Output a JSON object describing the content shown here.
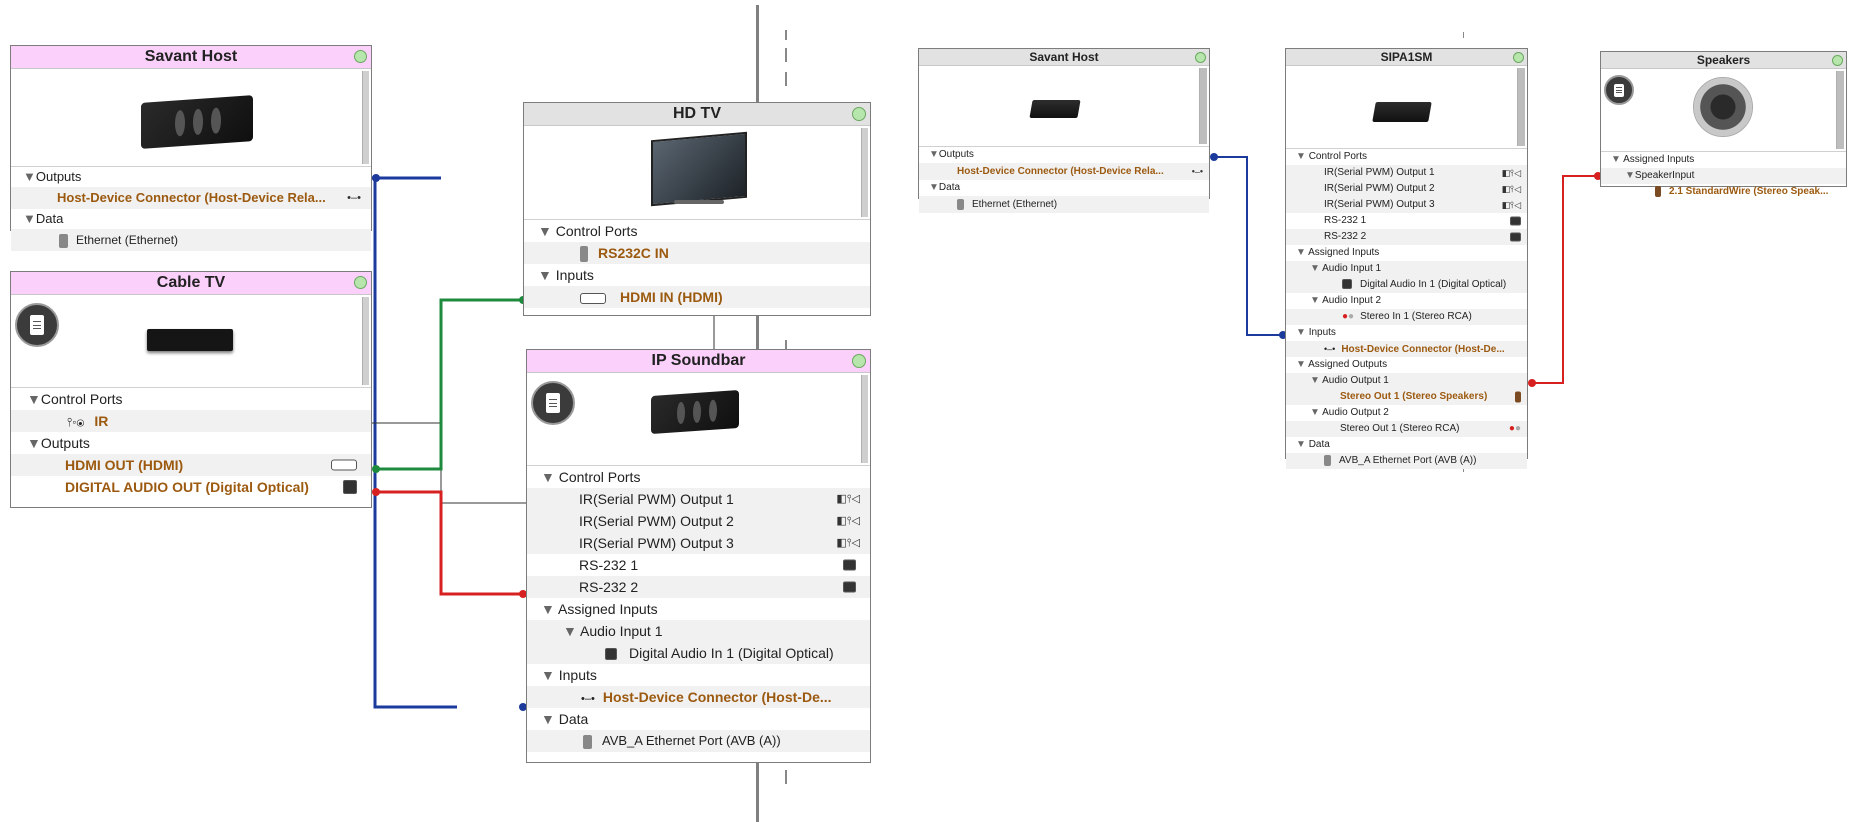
{
  "left": {
    "savant_host": {
      "title": "Savant Host",
      "outputs": "Outputs",
      "connector": "Host-Device Connector (Host-Device Rela...",
      "data": "Data",
      "ethernet": "Ethernet (Ethernet)"
    },
    "cable_tv": {
      "title": "Cable TV",
      "control_ports": "Control Ports",
      "ir": "IR",
      "outputs": "Outputs",
      "hdmi_out": "HDMI OUT (HDMI)",
      "digital_out": "DIGITAL AUDIO OUT (Digital Optical)"
    },
    "hd_tv": {
      "title": "HD TV",
      "control_ports": "Control Ports",
      "rs232": "RS232C IN",
      "inputs": "Inputs",
      "hdmi_in": "HDMI IN (HDMI)"
    },
    "ip_soundbar": {
      "title": "IP Soundbar",
      "control_ports": "Control Ports",
      "ports": [
        "IR(Serial PWM) Output 1",
        "IR(Serial PWM) Output 2",
        "IR(Serial PWM) Output 3",
        "RS-232 1",
        "RS-232 2"
      ],
      "assigned_inputs": "Assigned Inputs",
      "audio_input": "Audio Input 1",
      "digital_in": "Digital Audio In 1 (Digital Optical)",
      "inputs": "Inputs",
      "host_connector": "Host-Device Connector (Host-De...",
      "data": "Data",
      "avb": "AVB_A Ethernet Port (AVB (A))"
    }
  },
  "right": {
    "savant_host": {
      "title": "Savant Host",
      "outputs": "Outputs",
      "connector": "Host-Device Connector (Host-Device Rela...",
      "data": "Data",
      "ethernet": "Ethernet (Ethernet)"
    },
    "sipa": {
      "title": "SIPA1SM",
      "control_ports": "Control Ports",
      "ports": [
        "IR(Serial PWM) Output 1",
        "IR(Serial PWM) Output 2",
        "IR(Serial PWM) Output 3",
        "RS-232 1",
        "RS-232 2"
      ],
      "assigned_inputs": "Assigned Inputs",
      "audio_input_1": "Audio Input 1",
      "digital_in": "Digital Audio In 1 (Digital Optical)",
      "audio_input_2": "Audio Input 2",
      "stereo_in": "Stereo In 1 (Stereo RCA)",
      "inputs": "Inputs",
      "host_connector": "Host-Device Connector (Host-De...",
      "assigned_outputs": "Assigned Outputs",
      "audio_output_1": "Audio Output 1",
      "stereo_out_speakers": "Stereo Out 1 (Stereo Speakers)",
      "audio_output_2": "Audio Output 2",
      "stereo_out_rca": "Stereo Out 1 (Stereo RCA)",
      "data": "Data",
      "avb": "AVB_A Ethernet Port (AVB (A))"
    },
    "speakers": {
      "title": "Speakers",
      "assigned_inputs": "Assigned Inputs",
      "speaker_input": "SpeakerInput",
      "wire": "2.1 StandardWire (Stereo Speak..."
    }
  },
  "colors": {
    "blue": "#1b3a9c",
    "green": "#1e8a3e",
    "red": "#d72020",
    "pink_header": "#fbd0fb",
    "orange_label": "#9c5a10"
  }
}
